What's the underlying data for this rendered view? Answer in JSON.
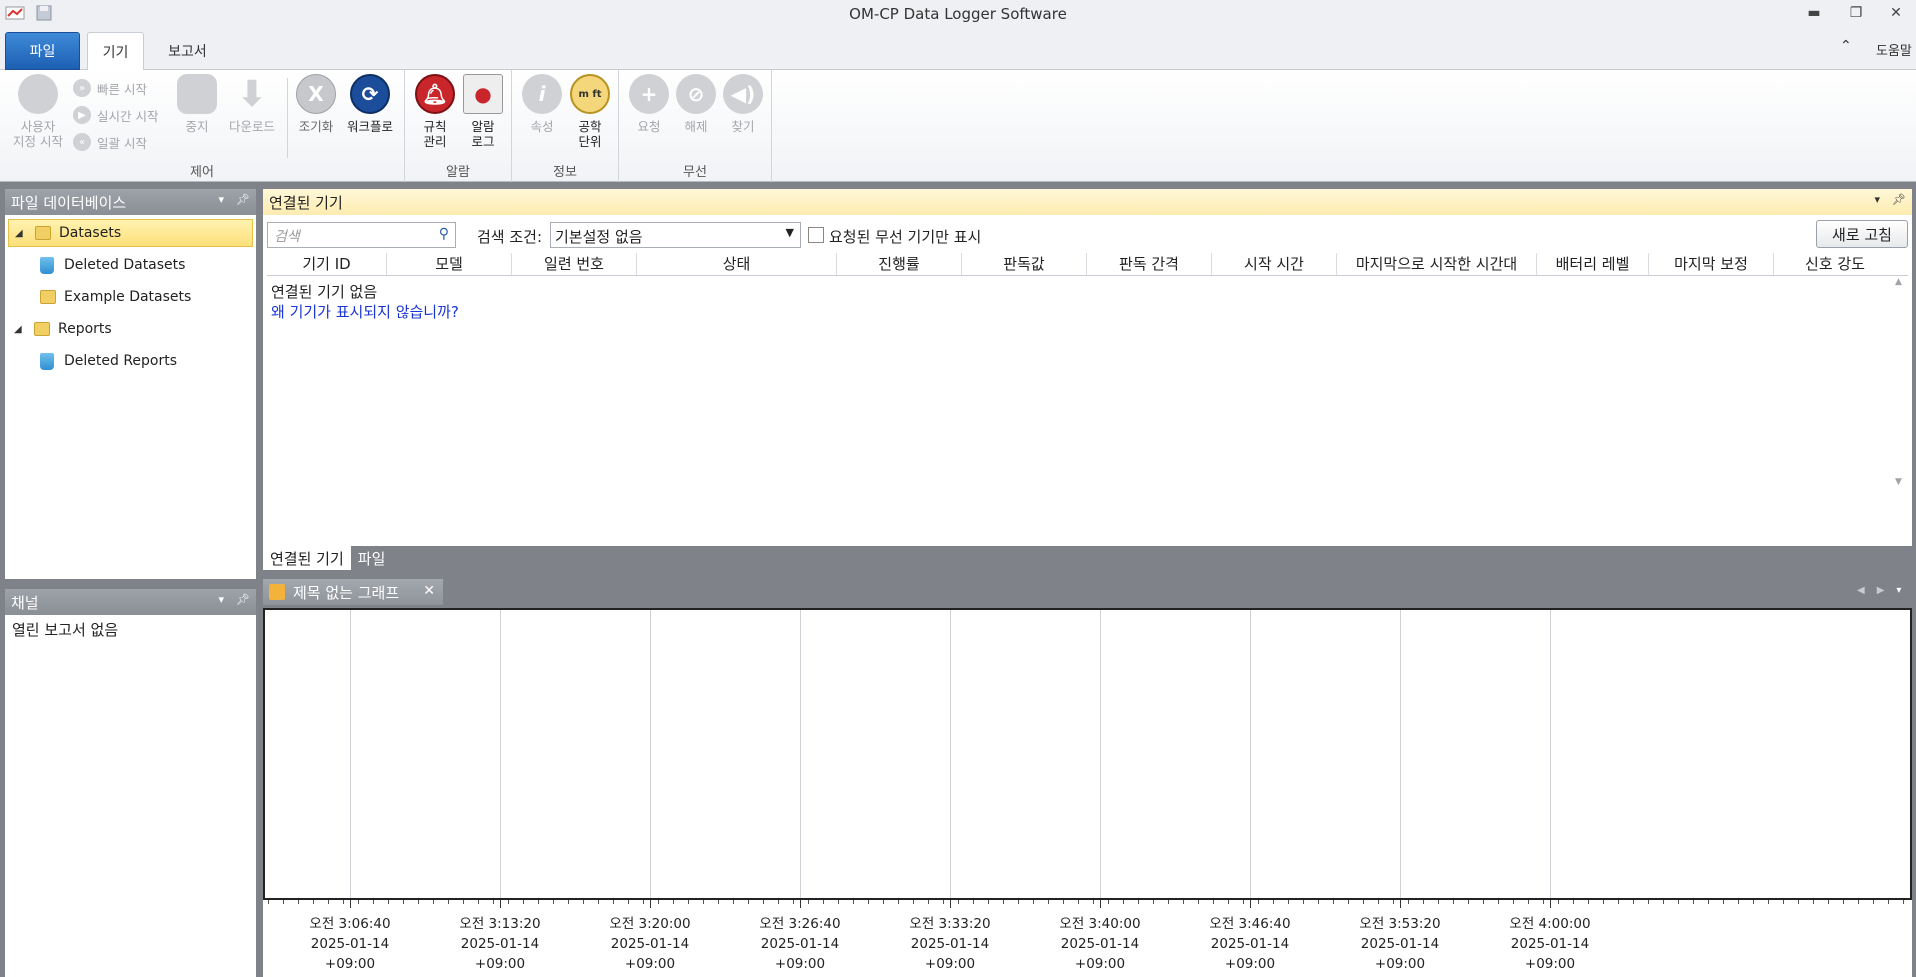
{
  "window": {
    "title": "OM-CP Data Logger Software"
  },
  "tabs": {
    "file": "파일",
    "device": "기기",
    "report": "보고서",
    "help": "도움말"
  },
  "ribbon": {
    "control": {
      "label": "제어",
      "custom_start": [
        "사용자",
        "지정 시작"
      ],
      "quick_start": "빠른 시작",
      "realtime_start": "실시간 시작",
      "batch_start": "일괄 시작",
      "stop": "중지",
      "download": "다운로드",
      "reset": "조기화",
      "workflow": "워크플로"
    },
    "alarm": {
      "label": "알람",
      "rule_manage": [
        "규칙",
        "관리"
      ],
      "alarm_log": [
        "알람",
        "로그"
      ]
    },
    "info": {
      "label": "정보",
      "properties": "속성",
      "eng_units": [
        "공학",
        "단위"
      ],
      "units_icon_text": "m ft"
    },
    "wireless": {
      "label": "무선",
      "request": "요청",
      "release": "해제",
      "find": "찾기"
    }
  },
  "file_db": {
    "title": "파일 데이터베이스",
    "tree": [
      {
        "label": "Datasets",
        "selected": true
      },
      {
        "label": "Deleted Datasets"
      },
      {
        "label": "Example Datasets"
      },
      {
        "label": "Reports"
      },
      {
        "label": "Deleted Reports"
      }
    ]
  },
  "channels": {
    "title": "채널",
    "empty": "열린 보고서 없음"
  },
  "devices": {
    "title": "연결된 기기",
    "search_placeholder": "검색",
    "condition_label": "검색 조건:",
    "condition_value": "기본설정 없음",
    "wireless_only": "요청된 무선 기기만 표시",
    "refresh": "새로 고침",
    "columns": [
      "기기 ID",
      "모델",
      "일련 번호",
      "상태",
      "진행률",
      "판독값",
      "판독 간격",
      "시작 시간",
      "마지막으로 시작한 시간대",
      "배터리 레벨",
      "마지막 보정",
      "신호 강도"
    ],
    "empty": "연결된 기기 없음",
    "why_link": "왜 기기가 표시되지 않습니까?"
  },
  "bottom_tabs": [
    "연결된 기기",
    "파일"
  ],
  "graph": {
    "tab_title": "제목 없는 그래프",
    "x_labels": [
      {
        "time": "오전 3:06:40",
        "date": "2025-01-14",
        "tz": "+09:00"
      },
      {
        "time": "오전 3:13:20",
        "date": "2025-01-14",
        "tz": "+09:00"
      },
      {
        "time": "오전 3:20:00",
        "date": "2025-01-14",
        "tz": "+09:00"
      },
      {
        "time": "오전 3:26:40",
        "date": "2025-01-14",
        "tz": "+09:00"
      },
      {
        "time": "오전 3:33:20",
        "date": "2025-01-14",
        "tz": "+09:00"
      },
      {
        "time": "오전 3:40:00",
        "date": "2025-01-14",
        "tz": "+09:00"
      },
      {
        "time": "오전 3:46:40",
        "date": "2025-01-14",
        "tz": "+09:00"
      },
      {
        "time": "오전 3:53:20",
        "date": "2025-01-14",
        "tz": "+09:00"
      },
      {
        "time": "오전 4:00:00",
        "date": "2025-01-14",
        "tz": "+09:00"
      }
    ]
  }
}
